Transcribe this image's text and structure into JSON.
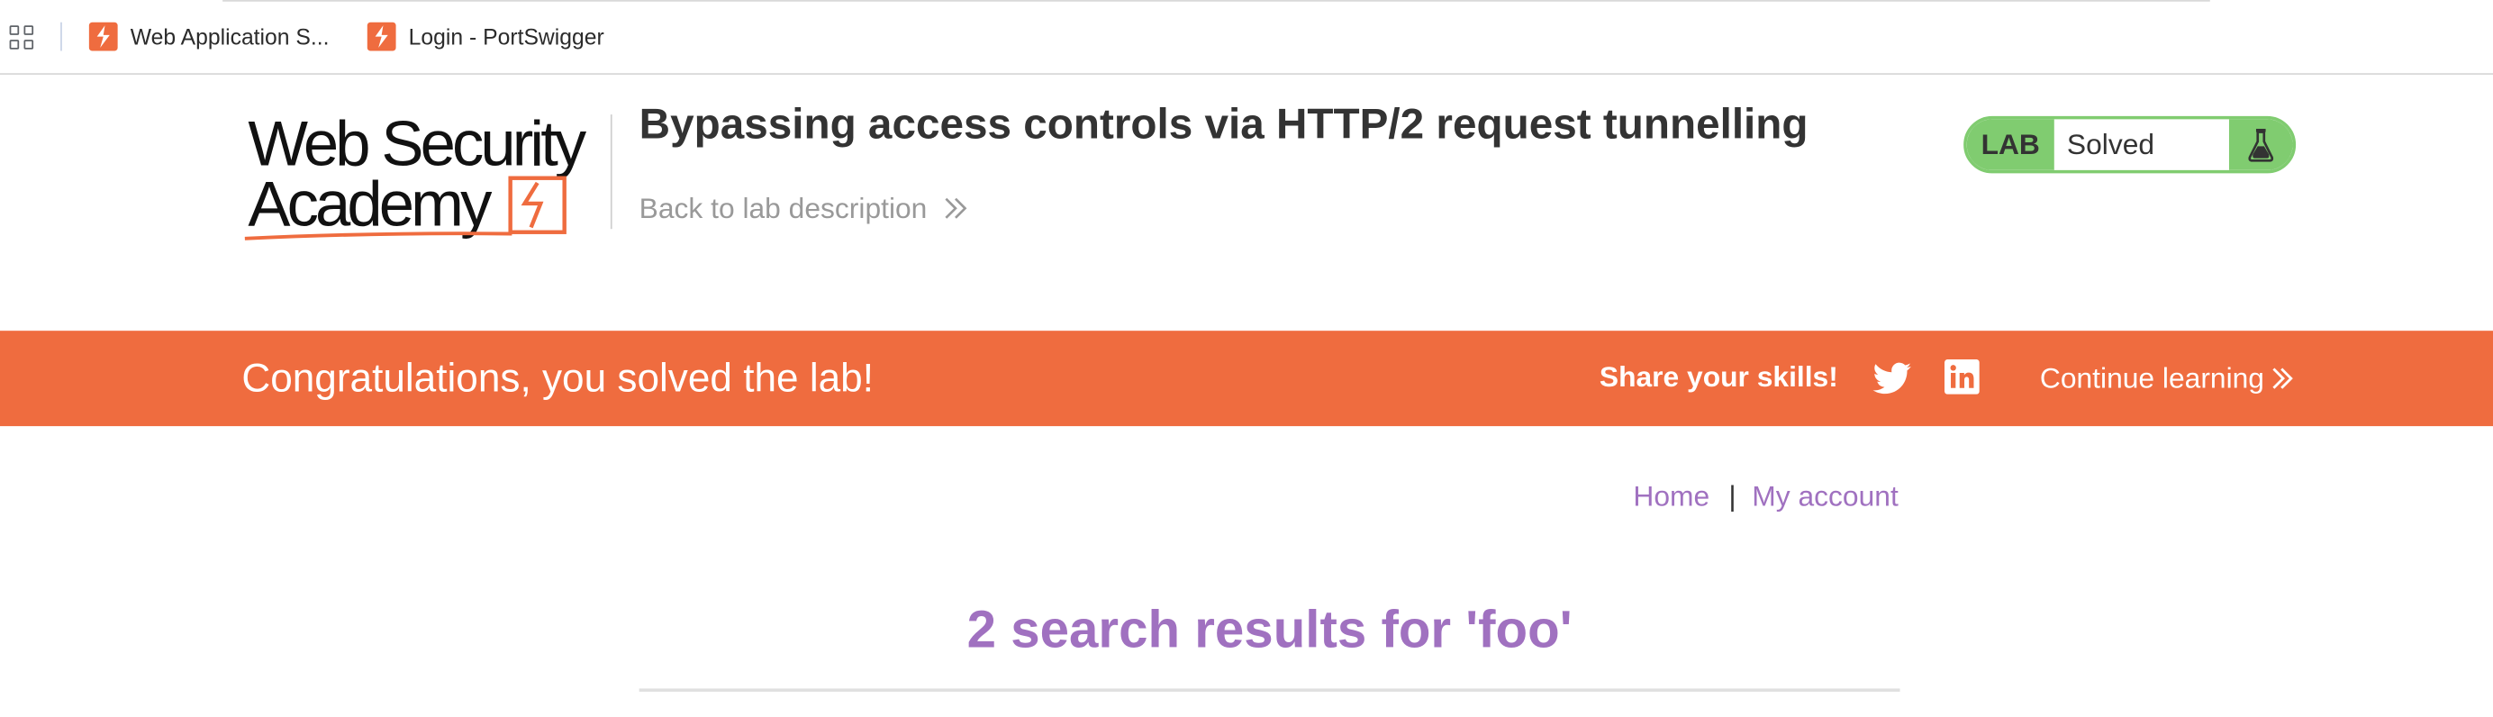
{
  "bookmarks": {
    "items": [
      {
        "label": "Web Application S...",
        "icon": "portswigger-favicon"
      },
      {
        "label": "Login - PortSwigger",
        "icon": "portswigger-favicon"
      }
    ]
  },
  "lab": {
    "logo_line1": "Web Security",
    "logo_line2": "Academy",
    "title": "Bypassing access controls via HTTP/2 request tunnelling",
    "back_link": "Back to lab description",
    "status_badge": "LAB",
    "status_text": "Solved",
    "status_icon": "flask-icon"
  },
  "banner": {
    "message": "Congratulations, you solved the lab!",
    "share_label": "Share your skills!",
    "continue_label": "Continue learning",
    "background": "#ef6c3f"
  },
  "nav": {
    "home": "Home",
    "separator": "|",
    "account": "My account"
  },
  "results": {
    "title": "2 search results for 'foo'"
  },
  "colors": {
    "accent_orange": "#ef6c3f",
    "status_green": "#80cc70",
    "link_purple": "#a071c0"
  }
}
